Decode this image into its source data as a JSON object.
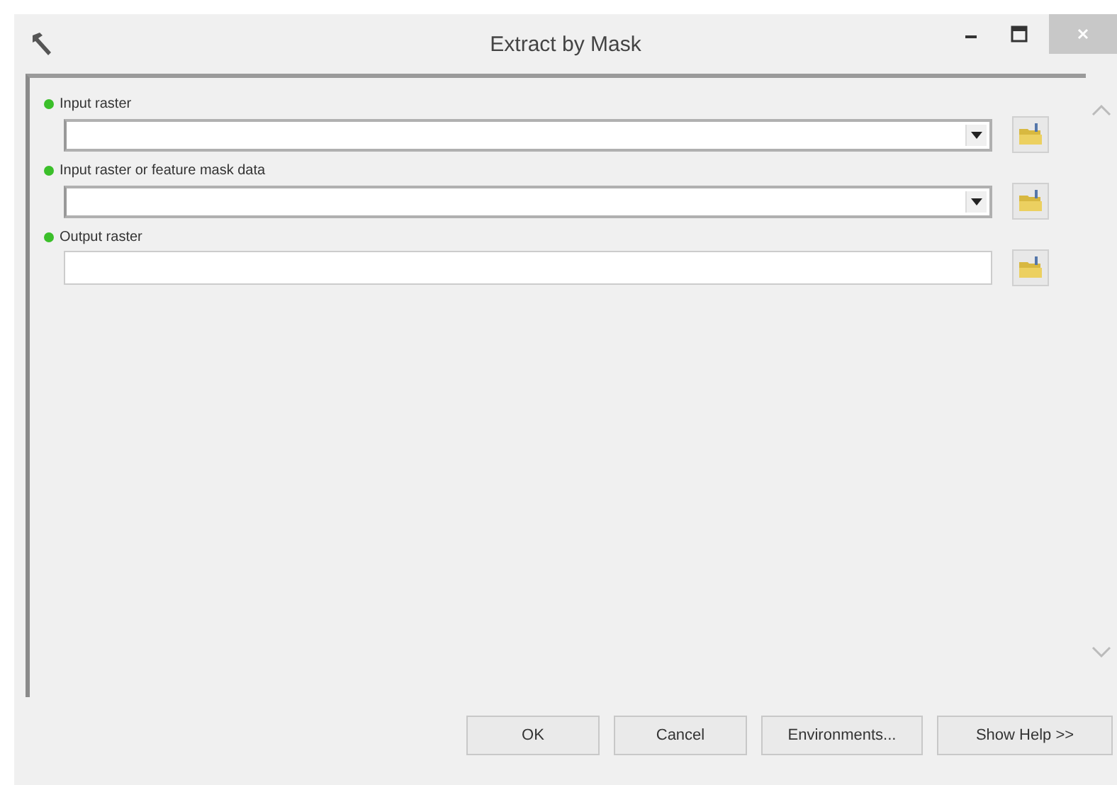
{
  "window": {
    "title": "Extract by Mask"
  },
  "parameters": [
    {
      "label": "Input raster",
      "kind": "combo",
      "required": true
    },
    {
      "label": "Input raster or feature mask data",
      "kind": "combo",
      "required": true
    },
    {
      "label": "Output raster",
      "kind": "text",
      "required": true
    }
  ],
  "buttons": [
    "OK",
    "Cancel",
    "Environments...",
    "Show Help >>"
  ]
}
